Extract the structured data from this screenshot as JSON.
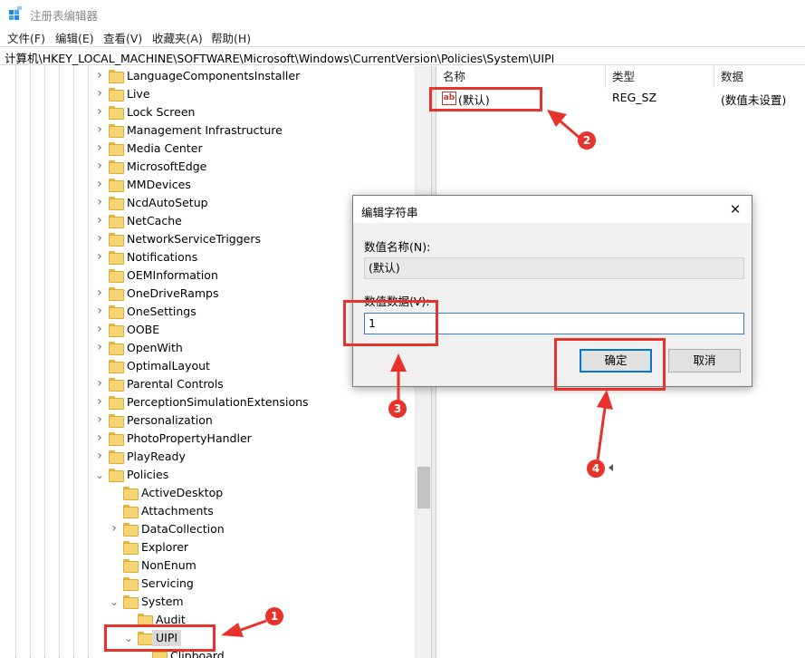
{
  "window": {
    "title": "注册表编辑器"
  },
  "menu": [
    "文件(F)",
    "编辑(E)",
    "查看(V)",
    "收藏夹(A)",
    "帮助(H)"
  ],
  "address": "计算机\\HKEY_LOCAL_MACHINE\\SOFTWARE\\Microsoft\\Windows\\CurrentVersion\\Policies\\System\\UIPI",
  "tree": {
    "items": [
      {
        "label": "LanguageComponentsInstaller",
        "level": 0,
        "expander": "collapsed"
      },
      {
        "label": "Live",
        "level": 0,
        "expander": "collapsed"
      },
      {
        "label": "Lock Screen",
        "level": 0,
        "expander": "collapsed"
      },
      {
        "label": "Management Infrastructure",
        "level": 0,
        "expander": "collapsed"
      },
      {
        "label": "Media Center",
        "level": 0,
        "expander": "collapsed"
      },
      {
        "label": "MicrosoftEdge",
        "level": 0,
        "expander": "collapsed"
      },
      {
        "label": "MMDevices",
        "level": 0,
        "expander": "collapsed"
      },
      {
        "label": "NcdAutoSetup",
        "level": 0,
        "expander": "collapsed"
      },
      {
        "label": "NetCache",
        "level": 0,
        "expander": "collapsed"
      },
      {
        "label": "NetworkServiceTriggers",
        "level": 0,
        "expander": "collapsed"
      },
      {
        "label": "Notifications",
        "level": 0,
        "expander": "collapsed"
      },
      {
        "label": "OEMInformation",
        "level": 0,
        "expander": "none"
      },
      {
        "label": "OneDriveRamps",
        "level": 0,
        "expander": "collapsed"
      },
      {
        "label": "OneSettings",
        "level": 0,
        "expander": "collapsed"
      },
      {
        "label": "OOBE",
        "level": 0,
        "expander": "collapsed"
      },
      {
        "label": "OpenWith",
        "level": 0,
        "expander": "collapsed"
      },
      {
        "label": "OptimalLayout",
        "level": 0,
        "expander": "none"
      },
      {
        "label": "Parental Controls",
        "level": 0,
        "expander": "collapsed"
      },
      {
        "label": "PerceptionSimulationExtensions",
        "level": 0,
        "expander": "collapsed"
      },
      {
        "label": "Personalization",
        "level": 0,
        "expander": "collapsed"
      },
      {
        "label": "PhotoPropertyHandler",
        "level": 0,
        "expander": "collapsed"
      },
      {
        "label": "PlayReady",
        "level": 0,
        "expander": "collapsed"
      },
      {
        "label": "Policies",
        "level": 0,
        "expander": "expanded"
      },
      {
        "label": "ActiveDesktop",
        "level": 1,
        "expander": "none"
      },
      {
        "label": "Attachments",
        "level": 1,
        "expander": "none"
      },
      {
        "label": "DataCollection",
        "level": 1,
        "expander": "collapsed"
      },
      {
        "label": "Explorer",
        "level": 1,
        "expander": "none"
      },
      {
        "label": "NonEnum",
        "level": 1,
        "expander": "none"
      },
      {
        "label": "Servicing",
        "level": 1,
        "expander": "none"
      },
      {
        "label": "System",
        "level": 1,
        "expander": "expanded"
      },
      {
        "label": "Audit",
        "level": 2,
        "expander": "none"
      },
      {
        "label": "UIPI",
        "level": 2,
        "expander": "expanded",
        "selected": true
      },
      {
        "label": "Clipboard",
        "level": 3,
        "expander": "none"
      }
    ]
  },
  "list": {
    "headers": {
      "name": "名称",
      "type": "类型",
      "data": "数据"
    },
    "rows": [
      {
        "icon": "ab",
        "name": "(默认)",
        "type": "REG_SZ",
        "data": "(数值未设置)"
      }
    ]
  },
  "dialog": {
    "title": "编辑字符串",
    "close": "✕",
    "name_label": "数值名称(N):",
    "name_value": "(默认)",
    "data_label": "数值数据(V):",
    "data_value": "1",
    "ok": "确定",
    "cancel": "取消"
  },
  "annotations": [
    "1",
    "2",
    "3",
    "4"
  ],
  "colors": {
    "annotation": "#e8322c",
    "accent": "#0078d7",
    "folder": "#f8d573"
  }
}
